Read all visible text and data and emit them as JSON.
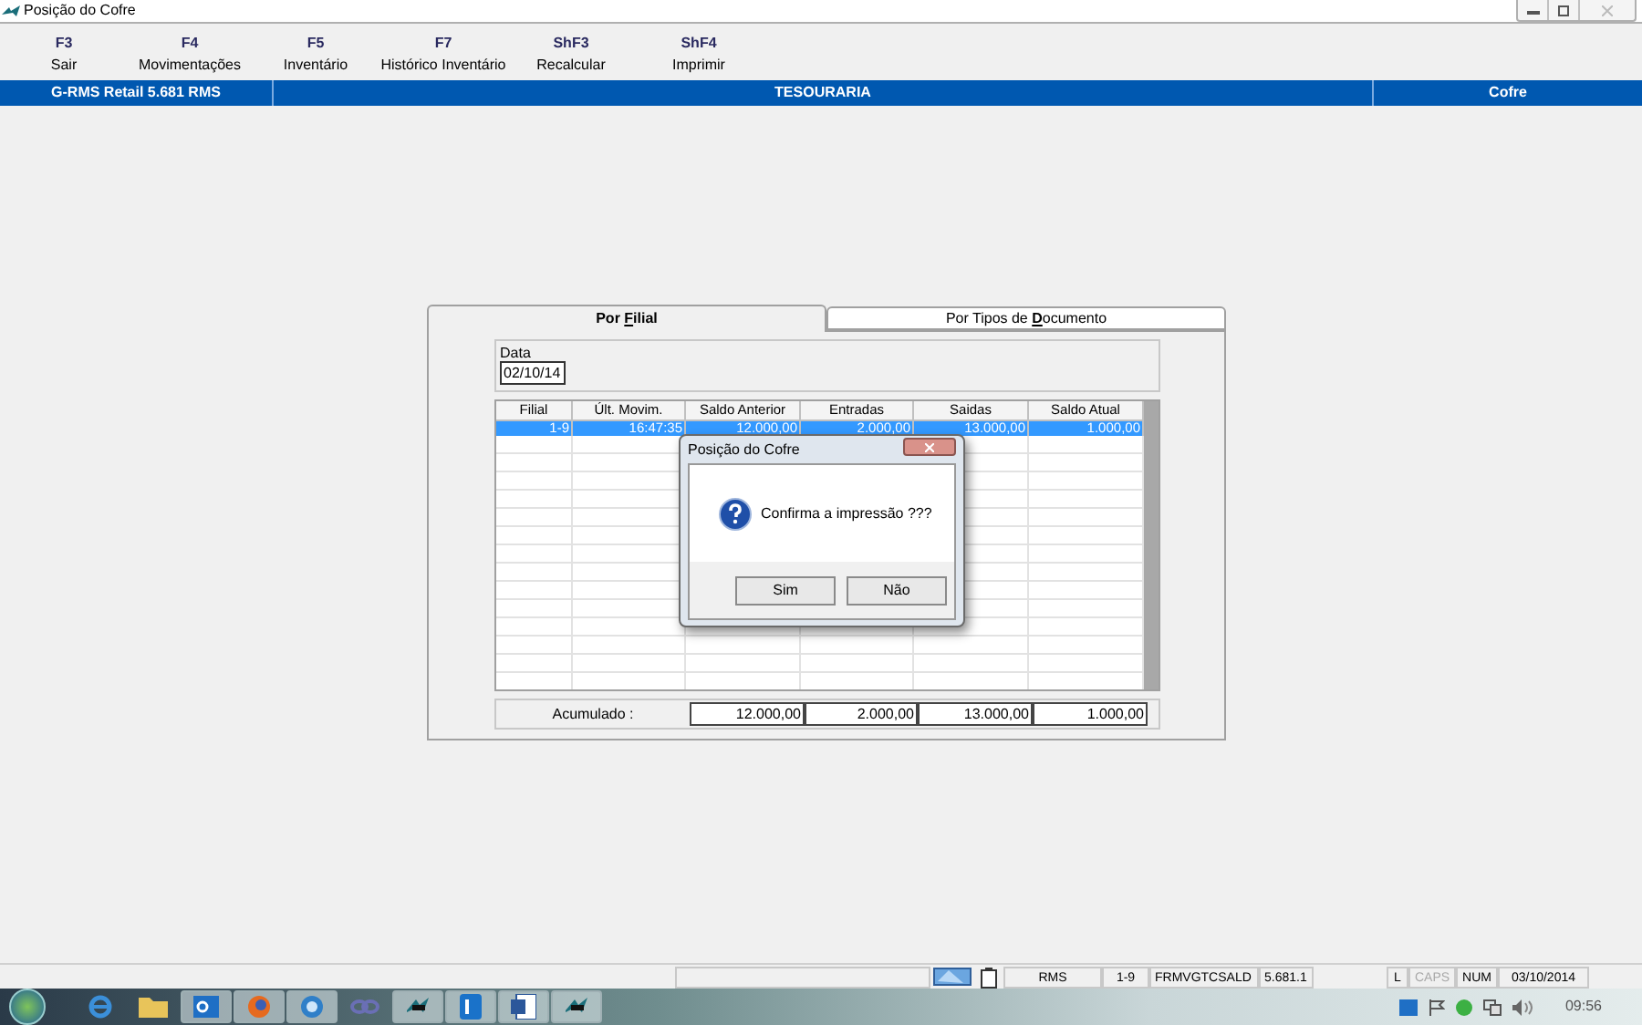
{
  "window": {
    "title": "Posição do Cofre"
  },
  "toolbar": [
    {
      "key": "F3",
      "label": "Sair"
    },
    {
      "key": "F4",
      "label": "Movimentações"
    },
    {
      "key": "F5",
      "label": "Inventário"
    },
    {
      "key": "F7",
      "label": "Histórico Inventário"
    },
    {
      "key": "ShF3",
      "label": "Recalcular"
    },
    {
      "key": "ShF4",
      "label": "Imprimir"
    }
  ],
  "header_bar": {
    "left": "G-RMS Retail 5.681 RMS",
    "center": "TESOURARIA",
    "right": "Cofre"
  },
  "tabs": [
    {
      "label": "Por **F**ilial",
      "selected": true
    },
    {
      "label": "Por Tipos de **D**ocumento",
      "selected": false
    }
  ],
  "date_field": {
    "label": "Data",
    "value": "02/10/14"
  },
  "table": {
    "columns": [
      "Filial",
      "Últ. Movim.",
      "Saldo Anterior",
      "Entradas",
      "Saidas",
      "Saldo Atual"
    ],
    "rows": [
      {
        "selected": true,
        "cells": [
          "1-9",
          "16:47:35",
          "12.000,00",
          "2.000,00",
          "13.000,00",
          "1.000,00"
        ]
      }
    ]
  },
  "totals": {
    "label": "Acumulado :",
    "values": [
      "12.000,00",
      "2.000,00",
      "13.000,00",
      "1.000,00"
    ]
  },
  "dialog": {
    "title": "Posição do Cofre",
    "message": "Confirma a impressão ???",
    "buttons": [
      "Sim",
      "Não"
    ]
  },
  "status_bar": [
    {
      "text": "RMS",
      "on": true
    },
    {
      "text": "1-9",
      "on": true
    },
    {
      "text": "FRMVGTCSALD",
      "on": true
    },
    {
      "text": "5.681.1",
      "on": true
    },
    {
      "text": "L",
      "on": true
    },
    {
      "text": "CAPS",
      "on": false
    },
    {
      "text": "NUM",
      "on": true
    },
    {
      "text": "03/10/2014",
      "on": true
    }
  ],
  "taskbar": {
    "items": [
      {
        "kind": "ie",
        "active": false
      },
      {
        "kind": "folder",
        "active": false
      },
      {
        "kind": "outlook",
        "active": true
      },
      {
        "kind": "firefox",
        "active": true
      },
      {
        "kind": "globe",
        "active": true
      },
      {
        "kind": "link",
        "active": false
      },
      {
        "kind": "rms",
        "active": true
      },
      {
        "kind": "lync",
        "active": true
      },
      {
        "kind": "word",
        "active": true
      },
      {
        "kind": "rms",
        "active": true
      }
    ],
    "clock": "09:56"
  }
}
